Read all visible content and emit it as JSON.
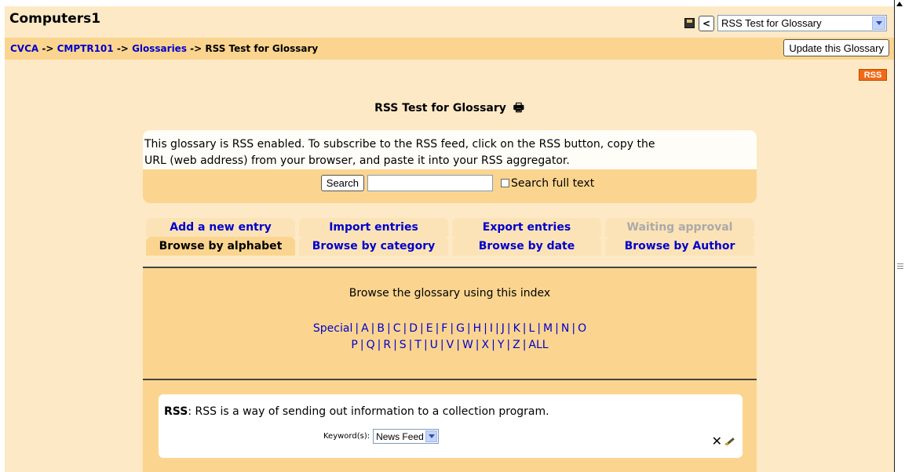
{
  "header": {
    "title": "Computers1",
    "back_label": "<",
    "select_value": "RSS Test for Glossary"
  },
  "breadcrumb": {
    "items": [
      "CVCA",
      "CMPTR101",
      "Glossaries"
    ],
    "separator": "->",
    "current": "RSS Test for Glossary"
  },
  "navbar": {
    "update_label": "Update this Glossary"
  },
  "rss_badge": "RSS",
  "heading": {
    "title": "RSS Test for Glossary"
  },
  "intro": {
    "line1": "This glossary is RSS enabled. To subscribe to the RSS feed, click on the RSS button, copy the",
    "line2": "URL (web address) from your browser, and paste it into your RSS aggregator."
  },
  "search": {
    "button_label": "Search",
    "input_value": "",
    "fulltext_label": "Search full text"
  },
  "tabs": {
    "row1": [
      "Add a new entry",
      "Import entries",
      "Export entries",
      "Waiting approval"
    ],
    "row2": [
      "Browse by alphabet",
      "Browse by category",
      "Browse by date",
      "Browse by Author"
    ]
  },
  "browse": {
    "caption": "Browse the glossary using this index",
    "line1": [
      "Special",
      "A",
      "B",
      "C",
      "D",
      "E",
      "F",
      "G",
      "H",
      "I",
      "J",
      "K",
      "L",
      "M",
      "N",
      "O"
    ],
    "line2": [
      "P",
      "Q",
      "R",
      "S",
      "T",
      "U",
      "V",
      "W",
      "X",
      "Y",
      "Z",
      "ALL"
    ]
  },
  "entry": {
    "term": "RSS",
    "definition": ": RSS is a way of sending out information to a collection program.",
    "keyword_label": "Keyword(s):",
    "keyword_value": "News Feed"
  }
}
